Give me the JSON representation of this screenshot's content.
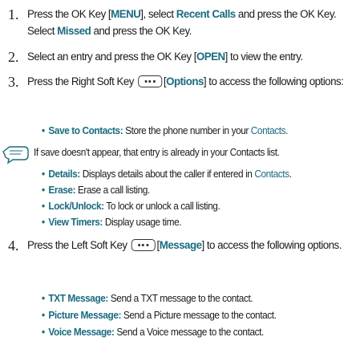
{
  "steps": [
    {
      "num": "1.",
      "parts": [
        "Press the OK Key [",
        "MENU",
        "], select ",
        "Recent Calls",
        " and press the OK Key. Select ",
        "Missed",
        " and press the OK Key."
      ]
    },
    {
      "num": "2.",
      "parts": [
        "Select an entry and press the OK Key [",
        "OPEN",
        "] to view the entry."
      ]
    },
    {
      "num": "3.",
      "parts": [
        "Press the Right Soft Key ",
        "[",
        "Options",
        "] to access the following options:"
      ],
      "bullets": [
        {
          "term": "Save to Contacts:",
          "desc": " Store the phone number in your ",
          "link": "Contacts",
          "end": "."
        }
      ],
      "note": "If save doesn't appear, that entry is already in your Contacts list.",
      "bullets2": [
        {
          "term": "Details:",
          "desc": " Displays details about the caller if entered in ",
          "link": "Contacts",
          "end": "."
        },
        {
          "term": "Erase:",
          "desc": " Erase a call listing.",
          "link": "",
          "end": ""
        },
        {
          "term": "Lock/Unlock:",
          "desc": " To lock or unlock a call listing.",
          "link": "",
          "end": ""
        },
        {
          "term": "View Timers:",
          "desc": " Display usage time.",
          "link": "",
          "end": ""
        }
      ]
    },
    {
      "num": "4.",
      "parts": [
        "Press the Left Soft Key ",
        "[",
        "Message",
        "] to access the following options."
      ],
      "bullets": [
        {
          "term": "TXT Message:",
          "desc": " Send a TXT message to the contact."
        },
        {
          "term": "Picture Message:",
          "desc": " Send a Picture message to the contact."
        },
        {
          "term": "Voice Message:",
          "desc": " Send a Voice message to the contact."
        }
      ]
    }
  ],
  "colors": {
    "accent": "#1a6b80",
    "text": "#1a1a1a"
  },
  "icons": {
    "note": "note-hand-icon",
    "softkey": "soft-key-icon"
  }
}
